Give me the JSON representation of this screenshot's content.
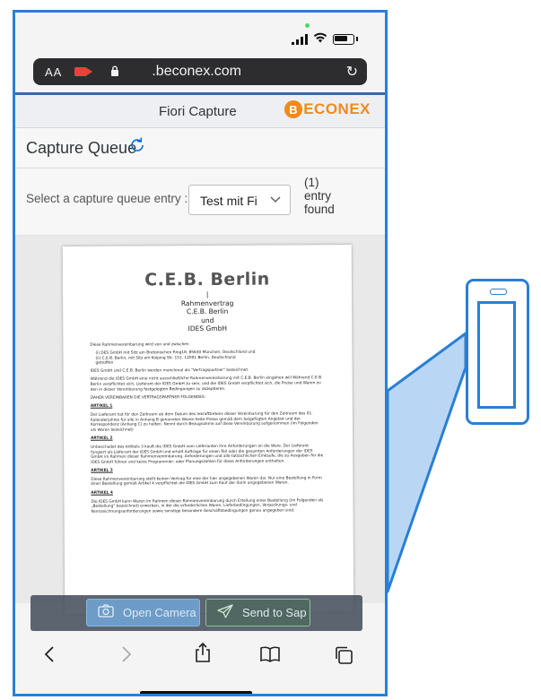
{
  "browser": {
    "text_size_label": "AA",
    "domain": ".beconex.com"
  },
  "app": {
    "title": "Fiori Capture",
    "logo_text": "ECONEX",
    "logo_mark": "B"
  },
  "page": {
    "title": "Capture Queue"
  },
  "queue_select": {
    "label": "Select a capture queue entry :",
    "value": "Test mit Fi",
    "count_line1": "(1)",
    "count_line2": "entry",
    "count_line3": "found"
  },
  "document": {
    "company": "C.E.B. Berlin",
    "head_lines": [
      "|",
      "Rahmenvertrag",
      "C.E.B. Berlin",
      "und",
      "IDES GmbH"
    ],
    "intro": "Diese Rahmenvereinbarung wird von und zwischen",
    "parties": [
      "(i) DES GmbH mit Sitz am Bretonischen Ring18, 85630 München, Deutschland und",
      "(ii) C.E.B. Berlin, mit Sitz am Kolping Str. 151, 12001 Berlin, Deutschland",
      "getroffen"
    ],
    "para1": "IDES GmbH und C.E.B. Berlin werden manchmal als \"Vertragspartner\" bezeichnet.",
    "para2": "Während die IDES GmbH eine nicht ausschließliche Rahmenvereinbarung mit C.E.B. Berlin eingehen will Während C.E.B. Berlin verpflichtet sich, Lieferant der IDES GmbH zu sein, und die IDES GmbH verpflichtet sich, die Preise und Waren zu den in dieser Vereinbarung festgelegten Bedingungen zu akzeptieren.",
    "para3": "DAHER VEREINBAREN DIE VERTRAGSPARTNER FOLGENDES:",
    "art1_title": "ARTIKEL 1",
    "art1": "Der Lieferant hat für den Zeitraum ab dem Datum des Inkrafttretens dieser Vereinbarung für den Zeitraum des 01. Kalenderjahres für alle in Anhang B genannten Waren feste Preise gemäß dem beigefügten Angebot und der Korrespondenz (Anhang C) zu halten. Nennt durch Bezugnahme auf diese Vereinbarung aufgenommen (im Folgenden als Waren bezeichnet)",
    "art2_title": "ARTIKEL 2",
    "art2": "Unbeschadet des Artikels 3 kauft die IDES GmbH vom Lieferanten ihre Anforderungen an die Ware. Der Lieferant fungiert als Lieferant der IDES GmbH und erhält Aufträge für einen Teil oder die gesamten Anforderungen der IDES GmbH im Rahmen dieser Rahmenvereinbarung. Anforderungen und alle tatsächlichen Einkäufe, die zu Ausgaben für die IDES GmbH führen und keine Programmier- oder Planungszahlen für diese Anforderungen enthalten.",
    "art3_title": "ARTIKEL 3",
    "art3": "Diese Rahmenvereinbarung stellt keinen Vertrag für eine der hier angegebenen Waren dar. Nur eine Bestellung in Form einer Bestellung gemäß Artikel 4 verpflichtet die IDES GmbH zum Kauf der darin angegebenen Waren.",
    "art4_title": "ARTIKEL 4",
    "art4": "Die IDES GmbH kann Waren im Rahmen dieser Rahmenvereinbarung durch Erteilung einer Bestellung (im Folgenden als „Bestellung\" bezeichnet) erwerben, in der die erforderlichen Waren, Lieferbedingungen, Verpackungs- und Kennzeichnungsanforderungen sowie sonstige besondere Geschäftsbedingungen genau angegeben sind."
  },
  "actions": {
    "open_camera": "Open Camera",
    "send_to_sap": "Send to Sap"
  },
  "colors": {
    "frame_blue": "#2a7fd4",
    "sap_blue": "#0a6ed1",
    "brand_orange": "#f08a1c"
  }
}
